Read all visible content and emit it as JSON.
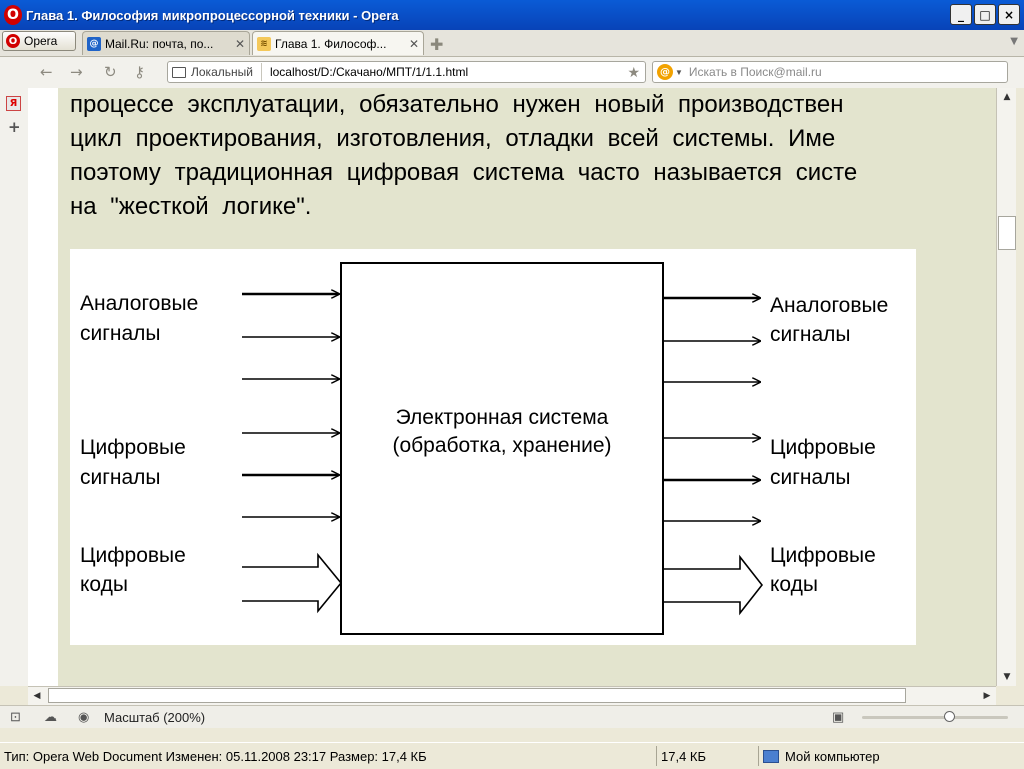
{
  "window": {
    "title": "Глава 1. Философия микропроцессорной техники - Opera"
  },
  "window_controls": {
    "minimize": "_",
    "maximize": "□",
    "close": "×"
  },
  "menu_button": {
    "label": "Opera"
  },
  "tabs": [
    {
      "label": "Mail.Ru: почта, по...",
      "active": false
    },
    {
      "label": "Глава 1. Философ...",
      "active": true
    }
  ],
  "address_bar": {
    "security_badge": "Локальный",
    "url": "localhost/D:/Скачано/МПТ/1/1.1.html"
  },
  "search_box": {
    "placeholder": "Искать в Поиск@mail.ru"
  },
  "page": {
    "paragraph_lines": [
      "процессе эксплуатации, обязательно нужен новый производствен",
      "цикл проектирования, изготовления, отладки всей системы. Име",
      "поэтому традиционная цифровая система часто называется систе",
      "на \"жесткой логике\"."
    ]
  },
  "diagram": {
    "center_box": {
      "line1": "Электронная система",
      "line2": "(обработка, хранение)"
    },
    "inputs": {
      "analog": [
        "Аналоговые",
        "сигналы"
      ],
      "digital": [
        "Цифровые",
        "сигналы"
      ],
      "codes": [
        "Цифровые",
        "коды"
      ]
    },
    "outputs": {
      "analog": [
        "Аналоговые",
        "сигналы"
      ],
      "digital": [
        "Цифровые",
        "сигналы"
      ],
      "codes": [
        "Цифровые",
        "коды"
      ]
    }
  },
  "opera_status": {
    "zoom": "Масштаб (200%)",
    "zoom_level": 0.6
  },
  "windows_status": {
    "info": "Тип: Opera Web Document Изменен: 05.11.2008 23:17 Размер: 17,4 КБ",
    "size": "17,4 КБ",
    "zone": "Мой компьютер"
  },
  "colors": {
    "titlebar": "#0843b8",
    "page_bg": "#e3e4ce",
    "opera_red": "#d10000"
  }
}
